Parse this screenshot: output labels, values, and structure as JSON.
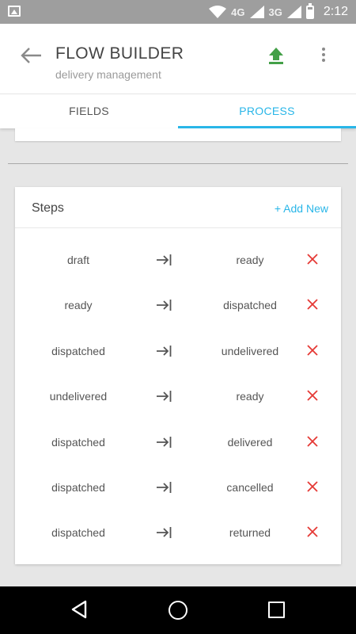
{
  "status_bar": {
    "network_1": "4G",
    "network_2": "3G",
    "time": "2:12"
  },
  "app_bar": {
    "title": "FLOW BUILDER",
    "subtitle": "delivery management",
    "upload_color": "#43a047"
  },
  "tabs": [
    {
      "label": "FIELDS",
      "active": false
    },
    {
      "label": "PROCESS",
      "active": true
    }
  ],
  "accent_color": "#29b6e8",
  "steps_card": {
    "title": "Steps",
    "add_label": "+ Add New",
    "delete_color": "#e53935",
    "steps": [
      {
        "from": "draft",
        "to": "ready"
      },
      {
        "from": "ready",
        "to": "dispatched"
      },
      {
        "from": "dispatched",
        "to": "undelivered"
      },
      {
        "from": "undelivered",
        "to": "ready"
      },
      {
        "from": "dispatched",
        "to": "delivered"
      },
      {
        "from": "dispatched",
        "to": "cancelled"
      },
      {
        "from": "dispatched",
        "to": "returned"
      }
    ]
  },
  "icons": {
    "back": "arrow-left-icon",
    "upload": "upload-icon",
    "more": "more-vert-icon",
    "transition": "arrow-to-right-icon",
    "delete": "close-icon"
  }
}
